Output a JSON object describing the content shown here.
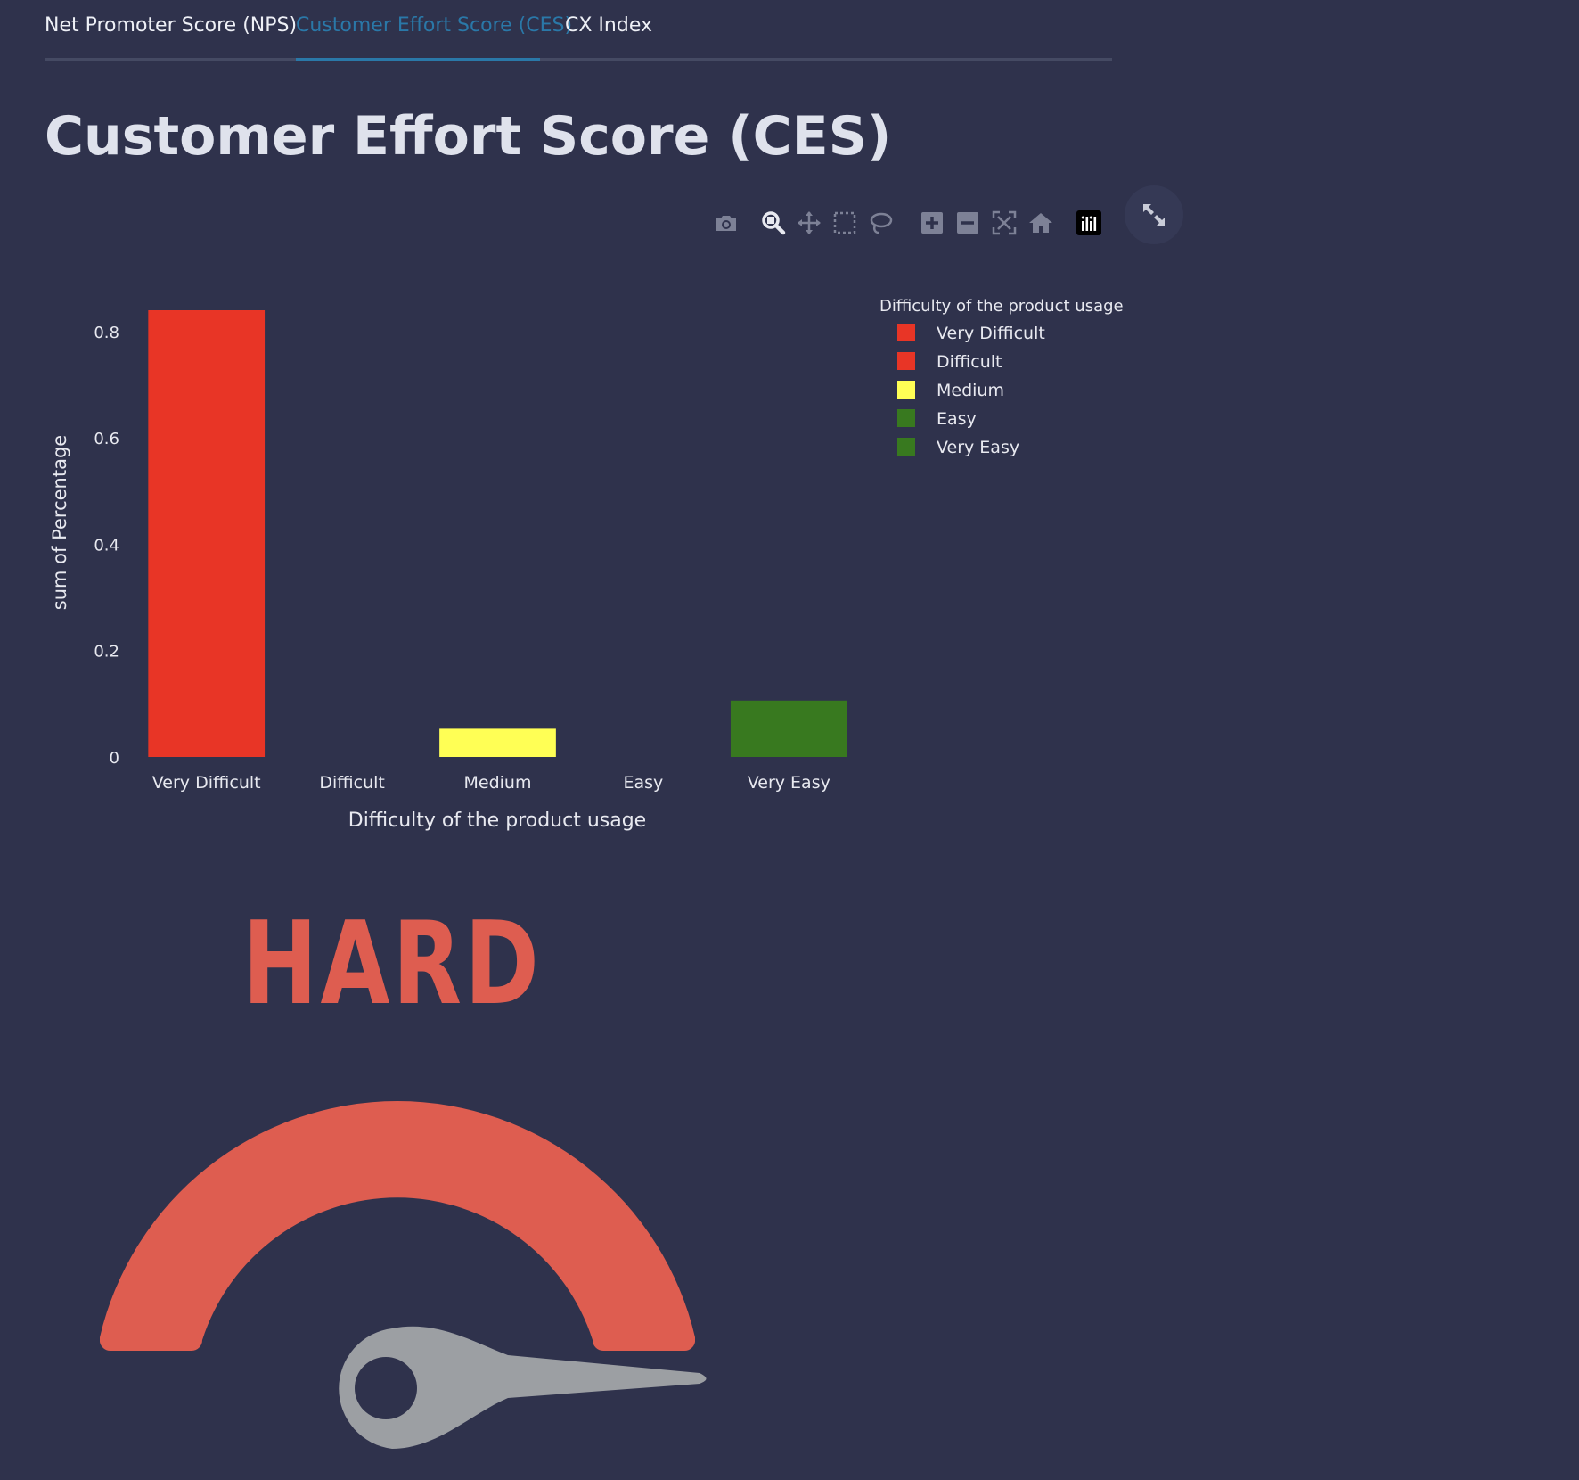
{
  "tabs": [
    {
      "label": "Net Promoter Score (NPS)",
      "active": false
    },
    {
      "label": "Customer Effort Score (CES)",
      "active": true
    },
    {
      "label": "CX Index",
      "active": false
    }
  ],
  "page_title": "Customer Effort Score (CES)",
  "toolbar_icons": [
    "camera-icon",
    "zoom-icon",
    "pan-icon",
    "box-select-icon",
    "lasso-select-icon",
    "zoom-in-icon",
    "zoom-out-icon",
    "autoscale-icon",
    "reset-axes-icon",
    "plotly-logo-icon"
  ],
  "chart_data": {
    "type": "bar",
    "categories": [
      "Very Difficult",
      "Difficult",
      "Medium",
      "Easy",
      "Very Easy"
    ],
    "values": [
      0.84,
      0,
      0.053,
      0,
      0.106
    ],
    "colors": [
      "#e83526",
      "#e83526",
      "#ffff55",
      "#38791f",
      "#38791f"
    ],
    "xlabel": "Difficulty of the product usage",
    "ylabel": "sum of Percentage",
    "ylim": [
      0,
      0.84
    ],
    "yticks": [
      0,
      0.2,
      0.4,
      0.6,
      0.8
    ],
    "ytick_labels": [
      "0",
      "0.2",
      "0.4",
      "0.6",
      "0.8"
    ],
    "grid": false,
    "legend": {
      "title": "Difficulty of the product usage",
      "placement": "top-right",
      "items": [
        "Very Difficult",
        "Difficult",
        "Medium",
        "Easy",
        "Very Easy"
      ]
    }
  },
  "gauge": {
    "label": "HARD",
    "arc_color": "#de5d50",
    "needle_color": "#9c9fa3",
    "level": "hard"
  }
}
